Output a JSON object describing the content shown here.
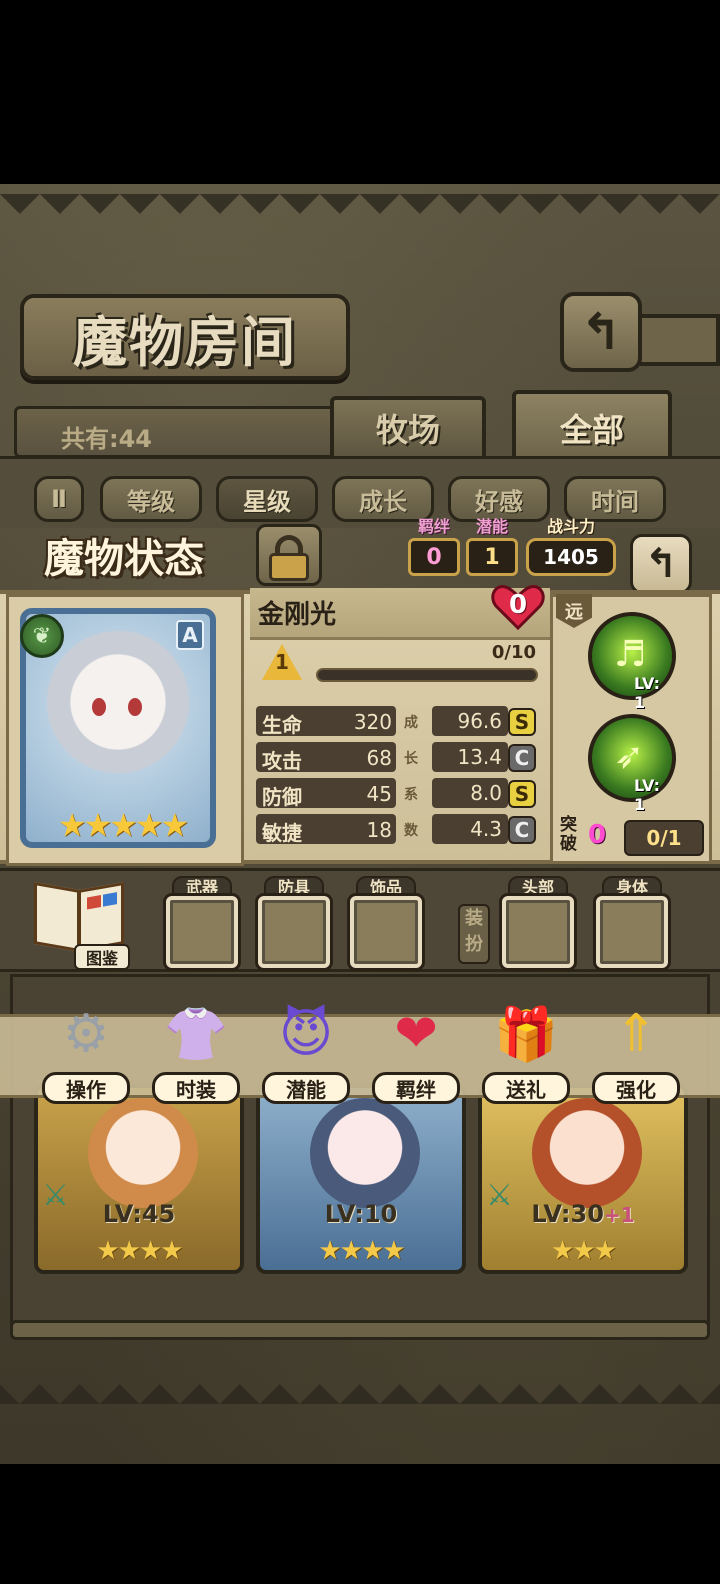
{
  "room": {
    "title": "魔物房间",
    "count_text": "共有:44"
  },
  "top_tabs": [
    "牧场",
    "全部"
  ],
  "sort": {
    "toggle": "Ⅱ",
    "options": [
      "等级",
      "星级",
      "成长",
      "好感",
      "时间"
    ],
    "active": "星级"
  },
  "status": {
    "title": "魔物状态",
    "bond": {
      "label": "羁绊",
      "value": "0"
    },
    "potential": {
      "label": "潜能",
      "value": "1"
    },
    "power": {
      "label": "战斗力",
      "value": "1405"
    },
    "name": "金刚光",
    "affection": "0",
    "rank": "A",
    "star_count": 5,
    "level": "1",
    "exp_text": "0/10",
    "exp_fraction": 0,
    "stats": [
      {
        "name": "生命",
        "value": "320",
        "growth": "96.6",
        "grade": "S"
      },
      {
        "name": "攻击",
        "value": "68",
        "growth": "13.4",
        "grade": "C"
      },
      {
        "name": "防御",
        "value": "45",
        "growth": "8.0",
        "grade": "S"
      },
      {
        "name": "敏捷",
        "value": "18",
        "growth": "4.3",
        "grade": "C"
      }
    ],
    "growth_label": [
      "成",
      "长",
      "系",
      "数"
    ],
    "range": "远",
    "skills": [
      {
        "lv": "LV: 1",
        "icon": "harp-skill-icon"
      },
      {
        "lv": "LV: 1",
        "icon": "triple-arrow-skill-icon"
      }
    ],
    "breakthrough": {
      "label": "突破",
      "num": "0",
      "value": "0/1"
    }
  },
  "equipment": {
    "book_label": "图鉴",
    "slots": [
      "武器",
      "防具",
      "饰品",
      "头部",
      "身体"
    ],
    "dress_label": "装扮"
  },
  "actions": [
    {
      "label": "操作",
      "icon": "gear-icon"
    },
    {
      "label": "时装",
      "icon": "outfit-icon"
    },
    {
      "label": "潜能",
      "icon": "demon-icon"
    },
    {
      "label": "羁绊",
      "icon": "hearts-icon"
    },
    {
      "label": "送礼",
      "icon": "gift-icon"
    },
    {
      "label": "强化",
      "icon": "upgrade-arrows-icon"
    }
  ],
  "monsters": [
    {
      "lv": "LV:45",
      "plus": "",
      "stars": 4
    },
    {
      "lv": "LV:10",
      "plus": "",
      "stars": 4
    },
    {
      "lv": "LV:30",
      "plus": "+1",
      "stars": 3
    }
  ],
  "colors": {
    "accent_gold": "#c9a24a",
    "pink": "#ff4bd0",
    "grade_s": "#e8d040",
    "grade_c": "#6a6a6a"
  }
}
